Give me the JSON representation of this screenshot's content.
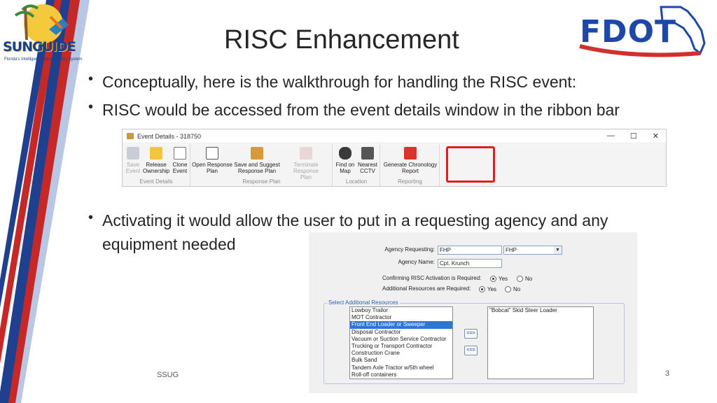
{
  "slide": {
    "title": "RISC Enhancement",
    "bullets": [
      "Conceptually, here is the walkthrough for handling the RISC event:",
      "RISC would be accessed from the event details window in the ribbon bar",
      "Activating it would allow the user to put in a requesting agency and any",
      "equipment needed"
    ],
    "footer": "SSUG",
    "page_number": "3"
  },
  "logos": {
    "left_word": "SUNGUIDE",
    "left_tagline": "Florida's Intelligent Transportation System",
    "right_word": "FDOT"
  },
  "ribbon": {
    "window_title": "Event Details - 318750",
    "controls": {
      "minimize": "—",
      "maximize": "☐",
      "close": "✕"
    },
    "groups": [
      {
        "name": "Event Details",
        "buttons": [
          {
            "label1": "Save",
            "label2": "Event",
            "icon": "save-icon",
            "disabled": true
          },
          {
            "label1": "Release",
            "label2": "Ownership",
            "icon": "lock-icon",
            "disabled": false
          },
          {
            "label1": "Clone",
            "label2": "Event",
            "icon": "clone-icon",
            "disabled": false
          }
        ]
      },
      {
        "name": "Response Plan",
        "buttons": [
          {
            "label1": "Open Response",
            "label2": "Plan",
            "icon": "list-icon",
            "disabled": false
          },
          {
            "label1": "Save and Suggest",
            "label2": "Response Plan",
            "icon": "tools-icon",
            "disabled": false
          },
          {
            "label1": "Terminate Response",
            "label2": "Plan",
            "icon": "terminate-icon",
            "disabled": true
          }
        ]
      },
      {
        "name": "Location",
        "buttons": [
          {
            "label1": "Find on",
            "label2": "Map",
            "icon": "binoculars-icon",
            "disabled": false
          },
          {
            "label1": "Nearest",
            "label2": "CCTV",
            "icon": "camera-icon",
            "disabled": false
          }
        ]
      },
      {
        "name": "Reporting",
        "buttons": [
          {
            "label1": "Generate Chronology",
            "label2": "Report",
            "icon": "pdf-icon",
            "disabled": false
          }
        ]
      }
    ],
    "colors": {
      "highlight": "#e11d1d"
    }
  },
  "dialog": {
    "agency_requesting_label": "Agency Requesting:",
    "agency_requesting_value": "FHP",
    "agency_requesting_select": "FHP",
    "agency_name_label": "Agency Name:",
    "agency_name_value": "Cpt. Krunch",
    "confirm_label": "Confirming RISC Activation is Required:",
    "confirm_yes": "Yes",
    "confirm_no": "No",
    "additional_label": "Additional Resources are Required:",
    "additional_yes": "Yes",
    "additional_no": "No",
    "resources_legend": "Select Additional Resources",
    "available_resources": [
      "Lowboy Trailor",
      "MOT Contractor",
      "Front End Loader or Sweeper",
      "Disposal Contractor",
      "Vacuum or Suction Service Contractor",
      "Trucking or Transport Contractor",
      "Construction Crane",
      "Bulk Sand",
      "Tandem Axle Tractor w/5th wheel",
      "Roll-off containers"
    ],
    "selected_index": 2,
    "selected_resources": [
      "\"Bobcat\" Skid Steer Loader"
    ],
    "add_button": "==>",
    "remove_button": "<=="
  }
}
